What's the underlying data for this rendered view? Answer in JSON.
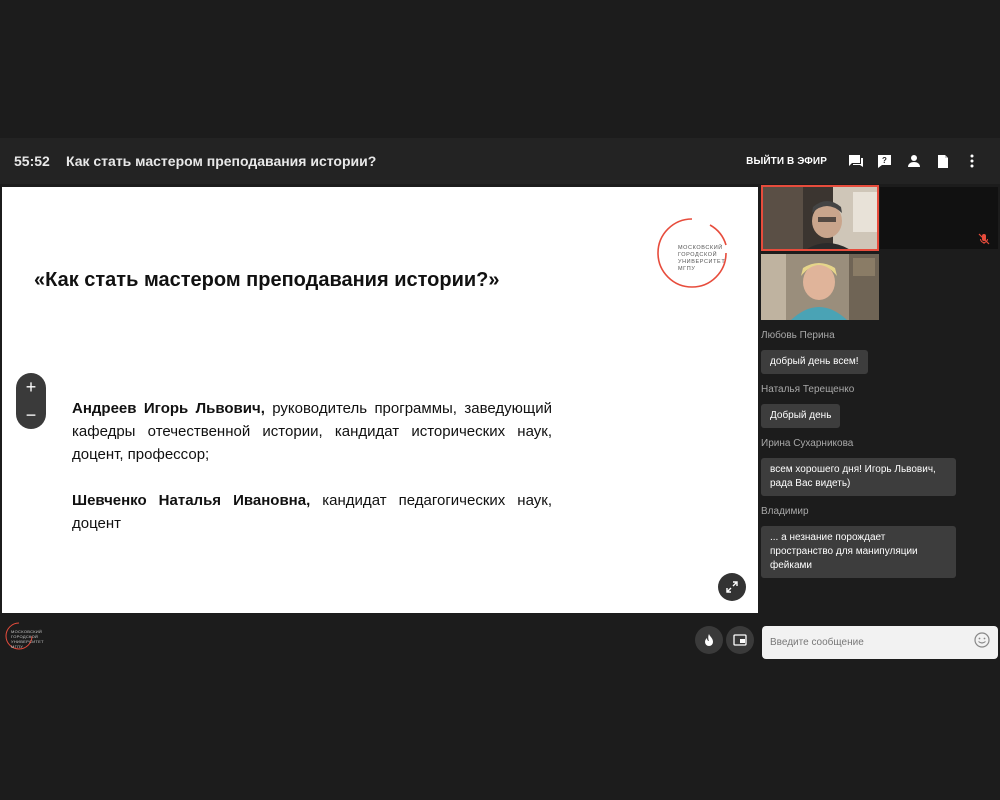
{
  "header": {
    "timer": "55:52",
    "title": "Как стать мастером преподавания истории?",
    "go_live_label": "ВЫЙТИ В ЭФИР",
    "icons": [
      "chat-icon",
      "question-icon",
      "person-icon",
      "document-icon",
      "more-vertical-icon"
    ]
  },
  "slide": {
    "title": "«Как стать мастером преподавания истории?»",
    "logo_lines": [
      "МОСКОВСКИЙ",
      "ГОРОДСКОЙ",
      "УНИВЕРСИТЕТ",
      "МГПУ"
    ],
    "speakers": [
      {
        "name": "Андреев Игорь Львович,",
        "description": " руководитель программы, заведующий кафедры отечественной истории, кандидат исторических наук, доцент, профессор;"
      },
      {
        "name": "Шевченко Наталья Ивановна,",
        "description": " кандидат педагогических наук, доцент"
      }
    ],
    "zoom_in": "+",
    "zoom_out": "−"
  },
  "chat": {
    "messages": [
      {
        "author": "Любовь Перина",
        "text": "добрый день всем!"
      },
      {
        "author": "Наталья Терещенко",
        "text": "Добрый день"
      },
      {
        "author": "Ирина Сухарникова",
        "text": "всем хорошего дня! Игорь Львович, рада Вас видеть)"
      },
      {
        "author": "Владимир",
        "text": "... а незнание порождает пространство для манипуляции фейками"
      }
    ],
    "input_placeholder": "Введите сообщение"
  },
  "bottom_logo_lines": [
    "МОСКОВСКИЙ",
    "ГОРОДСКОЙ",
    "УНИВЕРСИТЕТ",
    "МГПУ"
  ],
  "colors": {
    "accent": "#e74c3c",
    "background": "#1c1c1c",
    "topbar": "#232323",
    "bubble": "#3d3d3d"
  }
}
